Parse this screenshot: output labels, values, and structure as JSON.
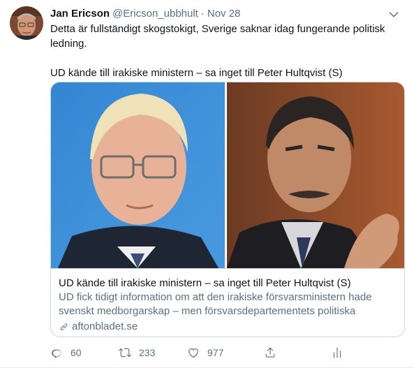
{
  "tweet": {
    "author_name": "Jan Ericson",
    "handle": "@Ericson_ubbhult",
    "separator": "·",
    "date": "Nov 28",
    "text_line1": "Detta är fullständigt skogstokigt, Sverige saknar idag fungerande politisk ledning.",
    "text_line2": "UD kände till irakiske ministern – sa inget till Peter Hultqvist (S)"
  },
  "card": {
    "title": "UD kände till irakiske ministern – sa inget till Peter Hultqvist (S)",
    "description": "UD fick tidigt information om att den irakiske försvarsministern hade svenskt medborgarskap – men försvarsdepartementets politiska ledning...",
    "domain": "aftonbladet.se"
  },
  "actions": {
    "replies": "60",
    "retweets": "233",
    "likes": "977"
  },
  "colors": {
    "text_primary": "#0f1419",
    "text_secondary": "#5b7083",
    "border": "#ccd6dd",
    "photo_left_background": "#3a8fd8",
    "photo_right_background": "#8a4a2a"
  },
  "icons": {
    "caret": "chevron-down-icon",
    "link": "link-icon",
    "reply": "reply-icon",
    "retweet": "retweet-icon",
    "like": "heart-icon",
    "share": "share-icon",
    "analytics": "analytics-icon"
  }
}
